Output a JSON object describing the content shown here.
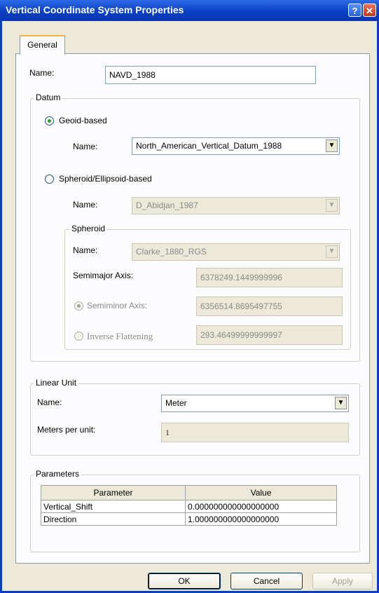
{
  "window": {
    "title": "Vertical Coordinate System Properties",
    "help_glyph": "?",
    "close_glyph": "✕"
  },
  "tabs": [
    {
      "label": "General"
    }
  ],
  "name_field": {
    "label": "Name:",
    "value": "NAVD_1988"
  },
  "datum": {
    "title": "Datum",
    "geoid": {
      "label": "Geoid-based",
      "name_label": "Name:",
      "name_value": "North_American_Vertical_Datum_1988"
    },
    "spheroid_based": {
      "label": "Spheroid/Ellipsoid-based",
      "name_label": "Name:",
      "name_value": "D_Abidjan_1987"
    },
    "spheroid": {
      "title": "Spheroid",
      "name_label": "Name:",
      "name_value": "Clarke_1880_RGS",
      "semimajor_label": "Semimajor Axis:",
      "semimajor_value": "6378249.1449999996",
      "semiminor_label": "Semiminor Axis:",
      "semiminor_value": "6356514.8695497755",
      "inverse_label": "Inverse Flattening",
      "inverse_value": "293.46499999999997"
    }
  },
  "linear_unit": {
    "title": "Linear Unit",
    "name_label": "Name:",
    "name_value": "Meter",
    "mpu_label": "Meters per unit:",
    "mpu_value": "1"
  },
  "parameters": {
    "title": "Parameters",
    "headers": [
      "Parameter",
      "Value"
    ],
    "rows": [
      {
        "name": "Vertical_Shift",
        "value": "0.000000000000000000"
      },
      {
        "name": "Direction",
        "value": "1.000000000000000000"
      }
    ]
  },
  "buttons": {
    "ok": "OK",
    "cancel": "Cancel",
    "apply": "Apply"
  },
  "colors": {
    "title_bar": "#0a3fc4",
    "dialog_bg": "#ece9d8",
    "panel_bg": "#fcfcfe",
    "radio_dot": "#21a121"
  }
}
